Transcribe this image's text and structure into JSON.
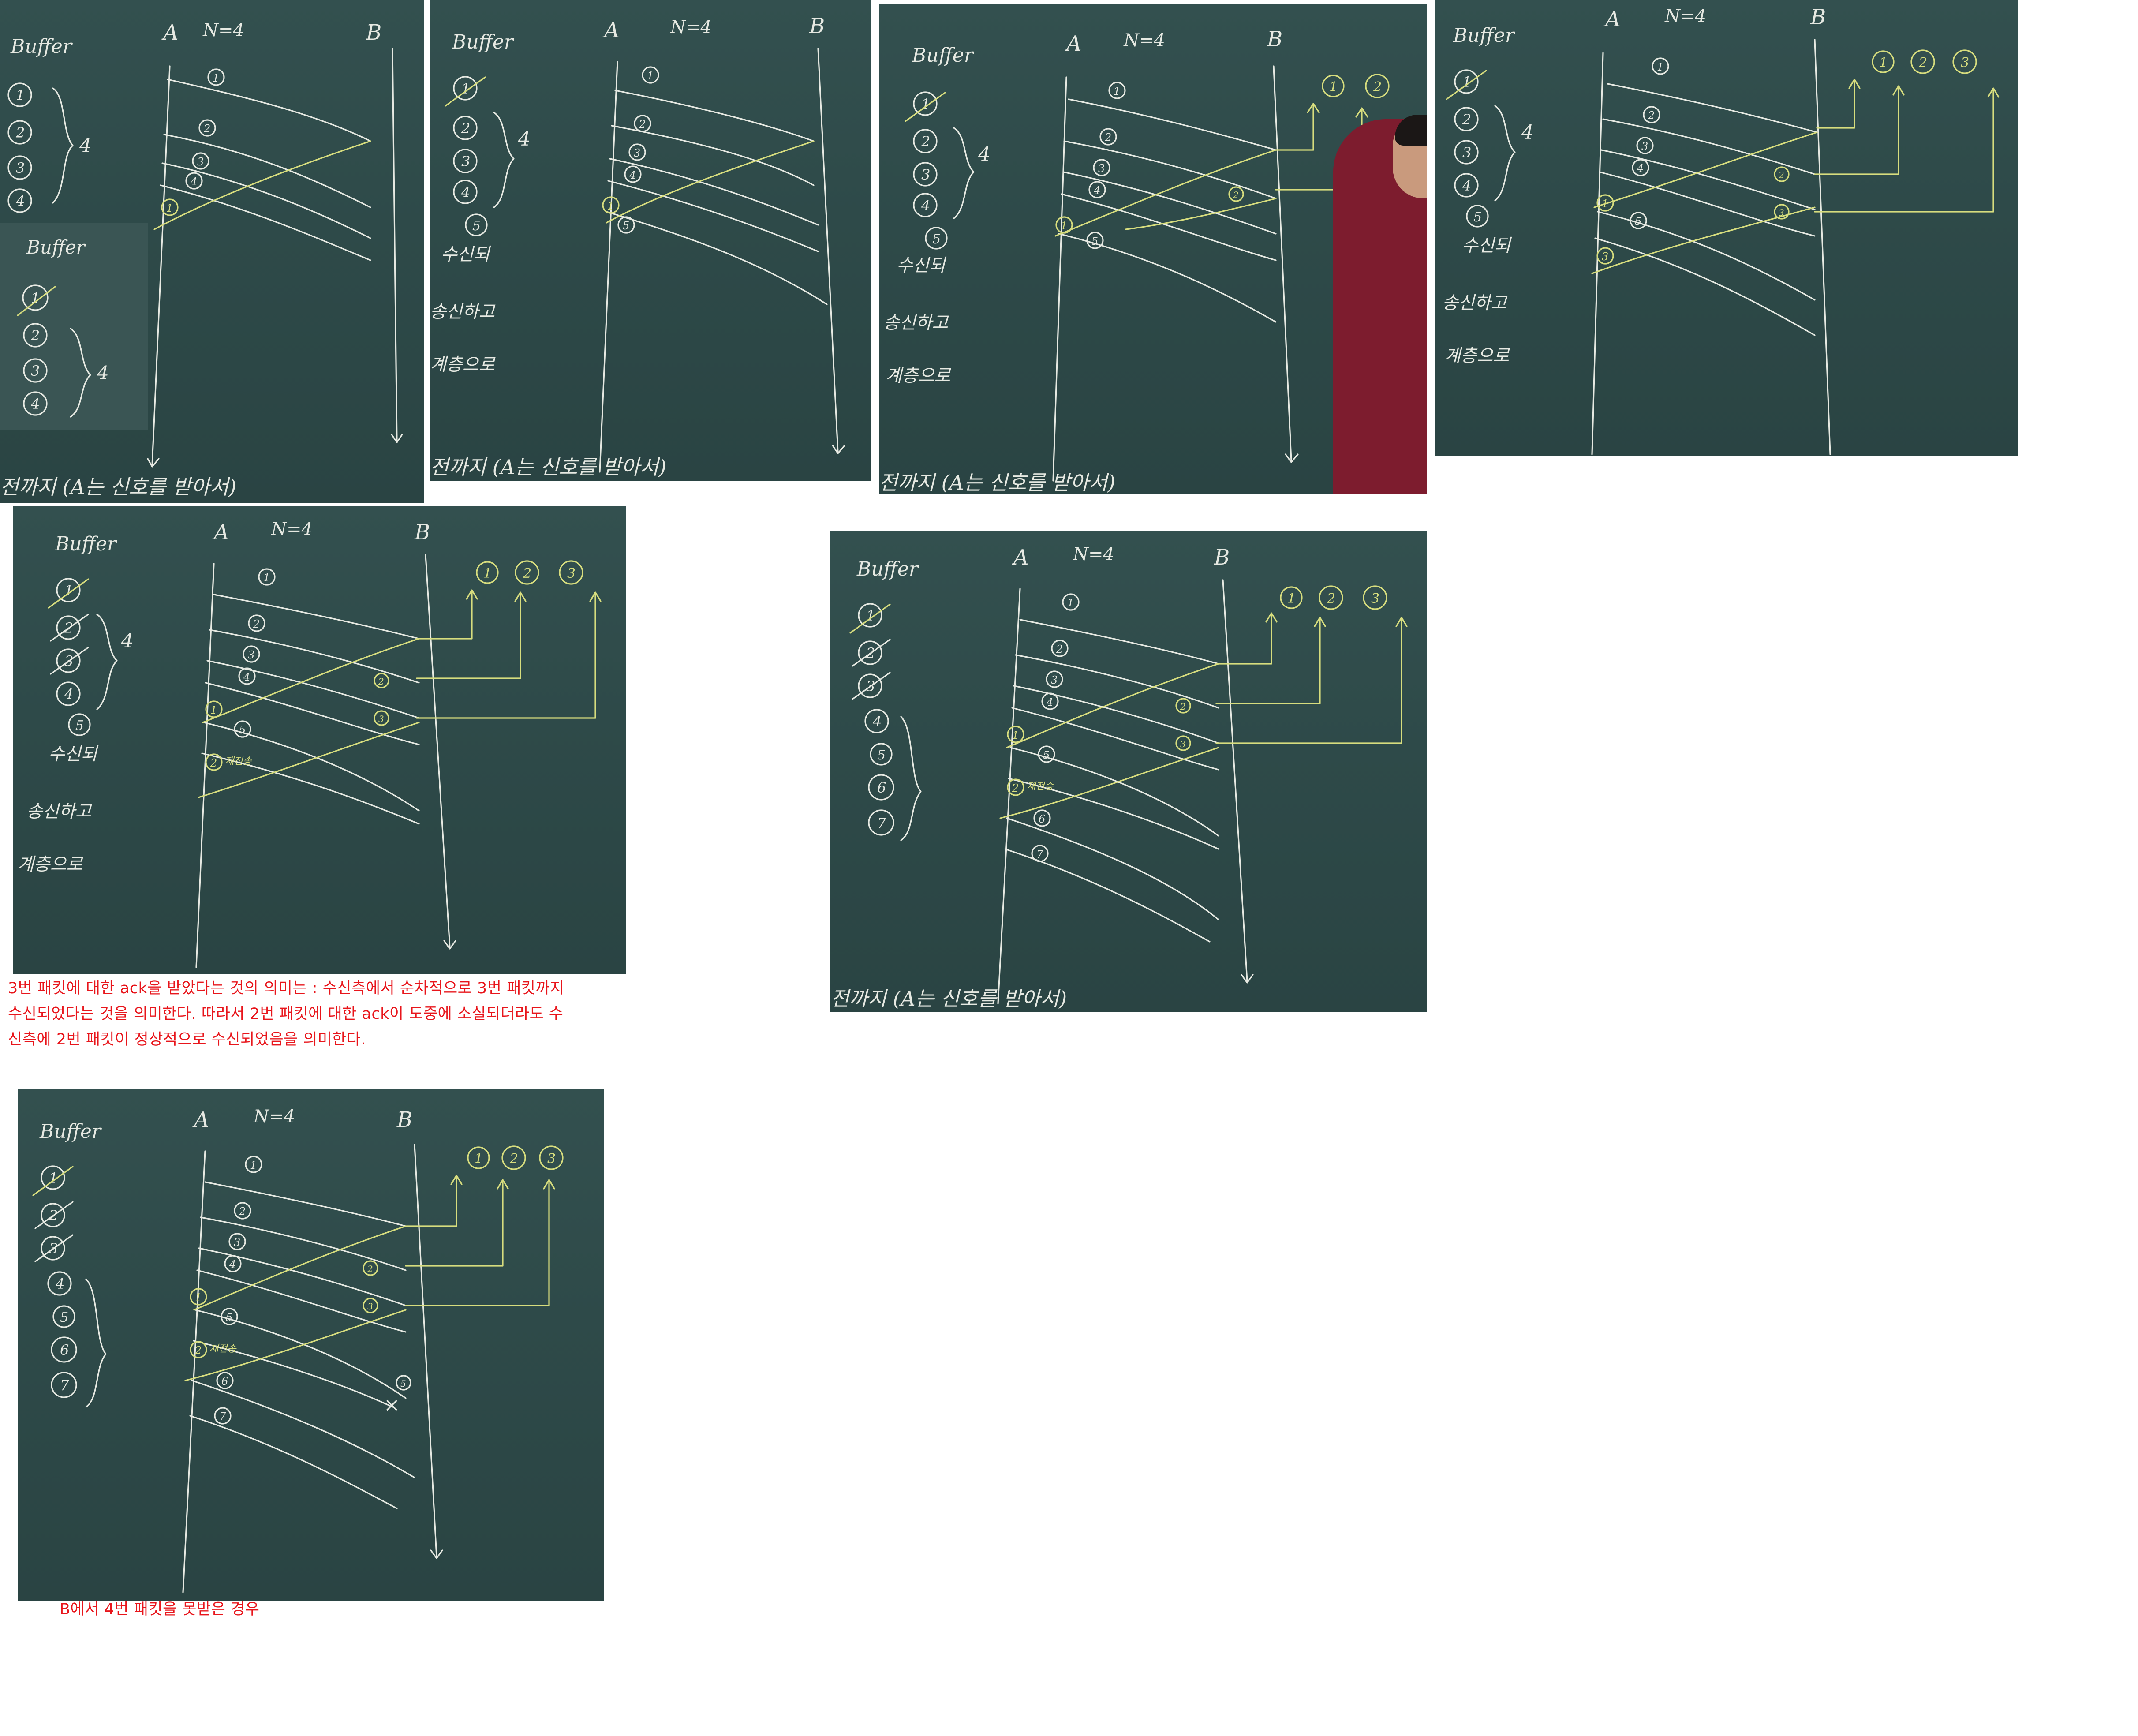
{
  "board": {
    "host_a": "A",
    "host_b": "B",
    "window_size": "N=4",
    "buffer_label": "Buffer",
    "window_brace_label": "4",
    "packet_labels": [
      "1",
      "2",
      "3",
      "4",
      "5",
      "6",
      "7"
    ],
    "ack_labels": [
      "1",
      "2",
      "3"
    ],
    "resend_label": "재전송",
    "lost_mark": "×",
    "side_notes": [
      "수신되",
      "송신하고",
      "계층으로"
    ],
    "bottom_note": "전까지 (A는 신호를 받아서)"
  },
  "colors": {
    "background": "#ffffff",
    "chalkboard": "#2e4a49",
    "chalk_white": "#e6e9e2",
    "chalk_yellow": "#d7dd7e",
    "caption_red": "#e8151b"
  },
  "captions": {
    "ack3_meaning": [
      "3번 패킷에 대한 ack을 받았다는 것의 의미는 : 수신측에서 순차적으로 3번 패킷까지",
      "수신되었다는 것을 의미한다. 따라서 2번 패킷에 대한 ack이 도중에 소실되더라도 수",
      "신측에 2번 패킷이 정상적으로 수신되었음을 의미한다."
    ],
    "packet4_lost": "B에서 4번 패킷을 못받은 경우"
  }
}
